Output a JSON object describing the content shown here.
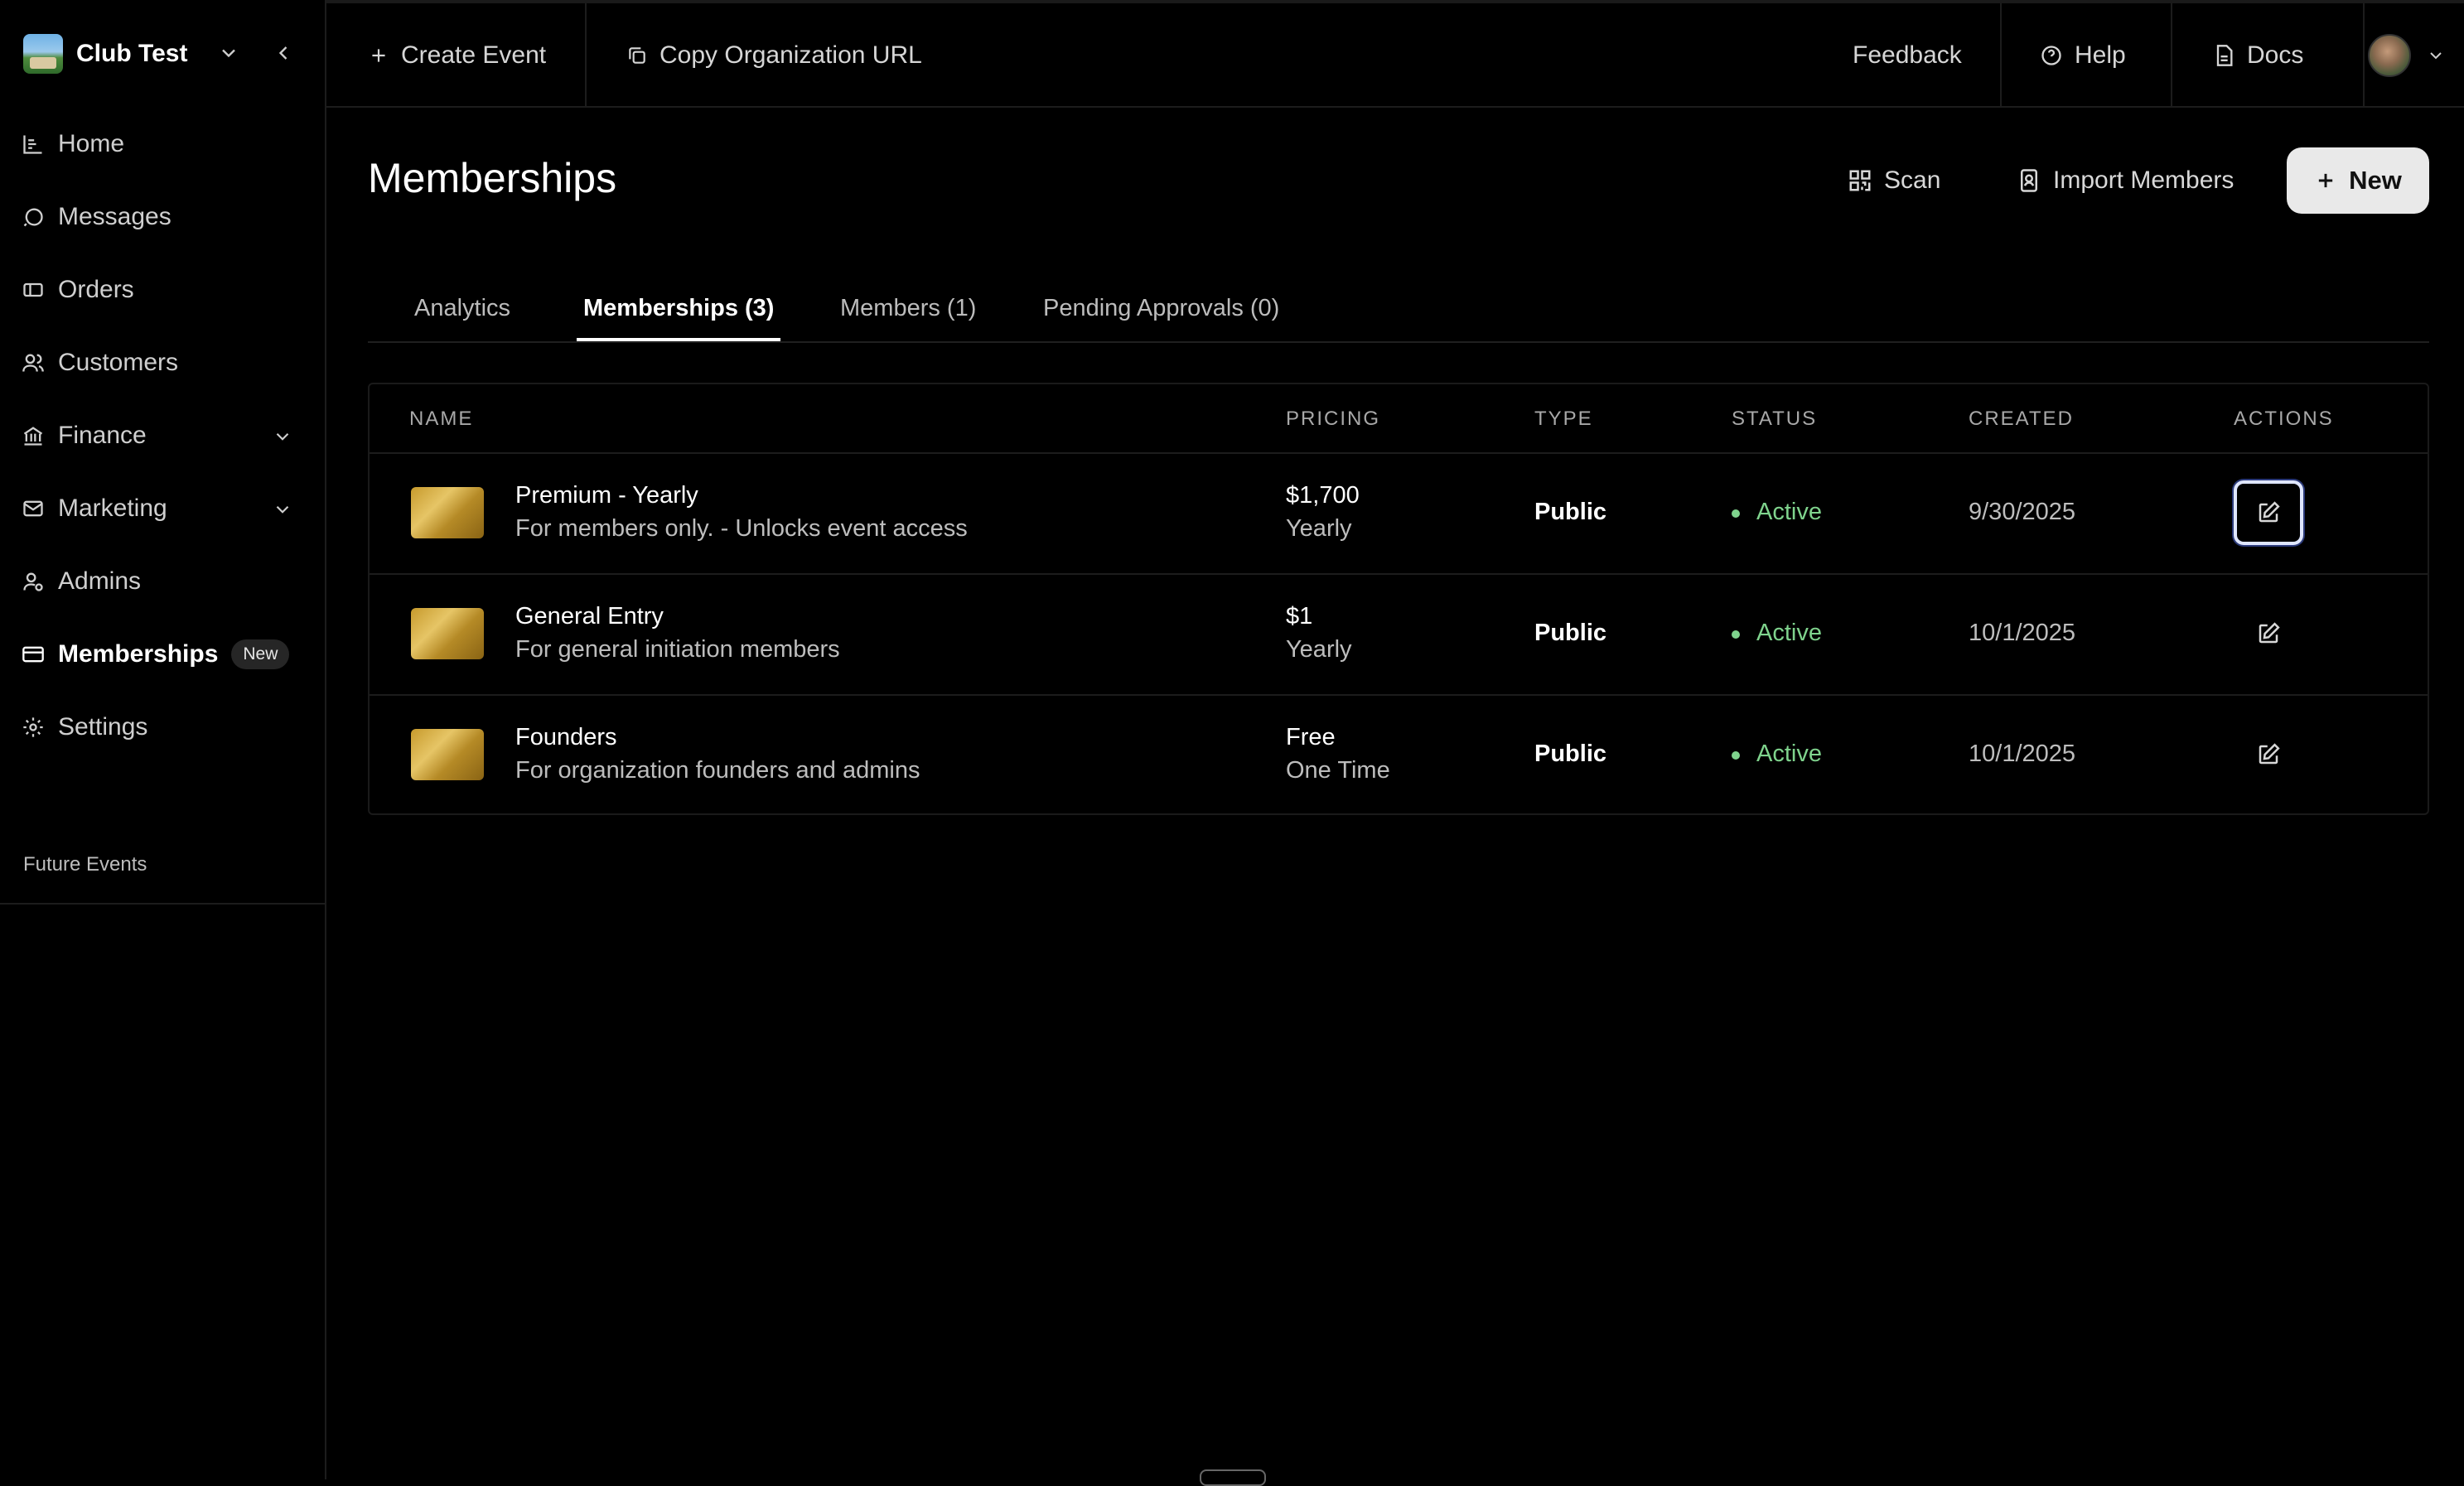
{
  "org": {
    "name": "Club Test"
  },
  "sidebar": {
    "items": [
      {
        "label": "Home",
        "icon": "chart-icon"
      },
      {
        "label": "Messages",
        "icon": "message-icon"
      },
      {
        "label": "Orders",
        "icon": "ticket-icon"
      },
      {
        "label": "Customers",
        "icon": "users-icon"
      },
      {
        "label": "Finance",
        "icon": "bank-icon",
        "expandable": true
      },
      {
        "label": "Marketing",
        "icon": "mail-icon",
        "expandable": true
      },
      {
        "label": "Admins",
        "icon": "user-gear-icon"
      },
      {
        "label": "Memberships",
        "icon": "card-icon",
        "active": true,
        "badge": "New"
      },
      {
        "label": "Settings",
        "icon": "gear-icon"
      }
    ],
    "section_label": "Future Events"
  },
  "topbar": {
    "create_event": "Create Event",
    "copy_url": "Copy Organization URL",
    "feedback": "Feedback",
    "help": "Help",
    "docs": "Docs"
  },
  "page": {
    "title": "Memberships",
    "scan": "Scan",
    "import": "Import Members",
    "new": "New"
  },
  "tabs": [
    {
      "label": "Analytics",
      "active": false
    },
    {
      "label": "Memberships (3)",
      "active": true
    },
    {
      "label": "Members (1)",
      "active": false
    },
    {
      "label": "Pending Approvals (0)",
      "active": false
    }
  ],
  "table": {
    "headers": [
      "NAME",
      "PRICING",
      "TYPE",
      "STATUS",
      "CREATED",
      "ACTIONS"
    ],
    "rows": [
      {
        "name": "Premium - Yearly",
        "description": "For members only. - Unlocks event access",
        "price": "$1,700",
        "cycle": "Yearly",
        "type": "Public",
        "status": "Active",
        "created": "9/30/2025"
      },
      {
        "name": "General Entry",
        "description": "For general initiation members",
        "price": "$1",
        "cycle": "Yearly",
        "type": "Public",
        "status": "Active",
        "created": "10/1/2025"
      },
      {
        "name": "Founders",
        "description": "For organization founders and admins",
        "price": "Free",
        "cycle": "One Time",
        "type": "Public",
        "status": "Active",
        "created": "10/1/2025"
      }
    ]
  },
  "colors": {
    "background": "#000000",
    "status_active": "#7fd38d",
    "new_button": "#e9e9e9"
  }
}
